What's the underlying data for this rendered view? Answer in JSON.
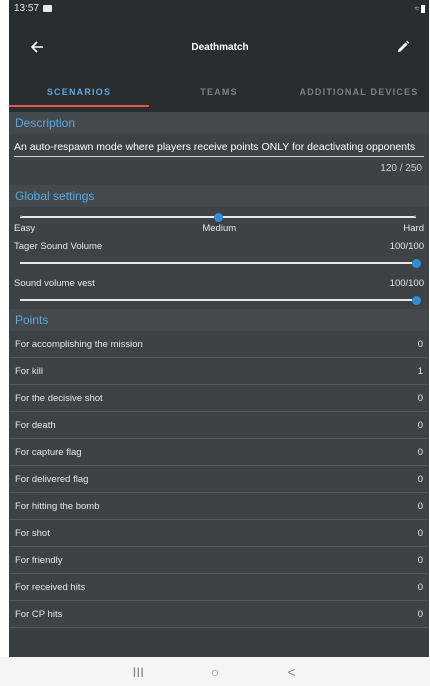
{
  "status_bar": {
    "time": "13:57"
  },
  "header": {
    "title": "Deathmatch",
    "back_icon": "arrow-left-icon",
    "edit_icon": "pencil-icon"
  },
  "tabs": [
    {
      "label": "SCENARIOS",
      "active": true
    },
    {
      "label": "TEAMS",
      "active": false
    },
    {
      "label": "ADDITIONAL DEVICES",
      "active": false
    }
  ],
  "description": {
    "header": "Description",
    "value": "An auto-respawn mode where players receive points ONLY for deactivating opponents",
    "counter": "120 / 250"
  },
  "global_settings": {
    "header": "Global settings",
    "difficulty": {
      "levels": [
        "Easy",
        "Medium",
        "Hard"
      ],
      "selected": "Medium",
      "fraction": 0.5
    },
    "tager_sound": {
      "label": "Tager Sound Volume",
      "value_text": "100/100",
      "fraction": 1.0
    },
    "vest_sound": {
      "label": "Sound volume vest",
      "value_text": "100/100",
      "fraction": 1.0
    }
  },
  "points": {
    "header": "Points",
    "rows": [
      {
        "label": "For accomplishing the mission",
        "value": "0"
      },
      {
        "label": "For kill",
        "value": "1"
      },
      {
        "label": "For the decisive shot",
        "value": "0"
      },
      {
        "label": "For death",
        "value": "0"
      },
      {
        "label": "For capture flag",
        "value": "0"
      },
      {
        "label": "For delivered flag",
        "value": "0"
      },
      {
        "label": "For hitting the bomb",
        "value": "0"
      },
      {
        "label": "For shot",
        "value": "0"
      },
      {
        "label": "For friendly",
        "value": "0"
      },
      {
        "label": "For received hits",
        "value": "0"
      },
      {
        "label": "For CP hits",
        "value": "0"
      }
    ]
  },
  "nav_bar": {
    "recent": "III",
    "home": "○",
    "back": "<"
  },
  "colors": {
    "accent": "#5aa9e0",
    "tab_indicator": "#e0594a",
    "slider": "#2e8fd8",
    "background": "#3a3e41"
  }
}
